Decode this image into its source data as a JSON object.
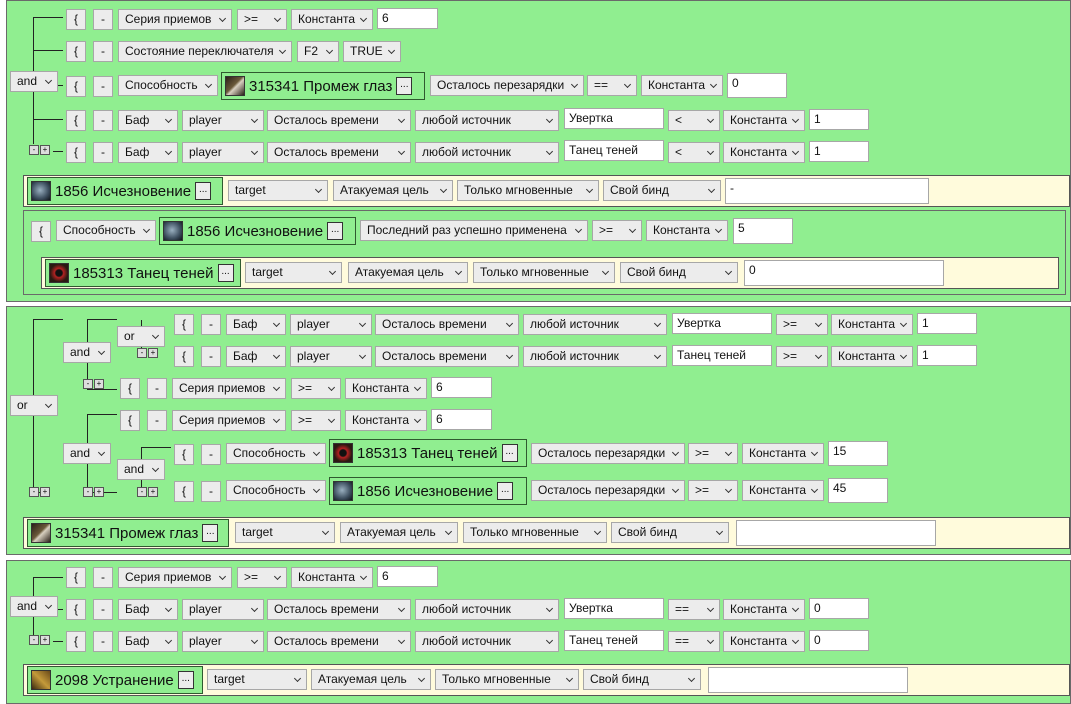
{
  "common": {
    "brace": "{",
    "dash": "-",
    "more": "...",
    "and": "and",
    "or": "or",
    "combo_series": "Серия приемов",
    "switch_state": "Состояние переключателя",
    "ability": "Способность",
    "buff": "Баф",
    "player": "player",
    "time_left": "Осталось времени",
    "any_source": "любой источник",
    "const": "Константа",
    "cd_left": "Осталось перезарядки",
    "last_success": "Последний раз успешно применена",
    "target": "target",
    "attacked": "Атакуемая цель",
    "instant": "Только мгновенные",
    "own_bind": "Свой бинд",
    "op_ge": ">=",
    "op_eq": "==",
    "op_lt": "<",
    "f2": "F2",
    "true_val": "TRUE",
    "evasion": "Увертка",
    "shadow_dance": "Танец теней"
  },
  "icons": [
    "blade-icon",
    "vanish-icon",
    "shadow-dance-icon",
    "eliminate-icon"
  ],
  "spells": {
    "s315341": "315341 Промеж глаз",
    "s1856": "1856 Исчезновение",
    "s185313": "185313 Танец теней",
    "s2098": "2098 Устранение"
  },
  "values": {
    "b1_r1": "6",
    "b1_r3": "0",
    "b1_r4": "1",
    "b1_r5": "1",
    "b1_act": "-",
    "b1_sub": "5",
    "b1_sub_act": "0",
    "b2_r1": "1",
    "b2_r2": "1",
    "b2_r3": "6",
    "b2_r4": "6",
    "b2_r5": "15",
    "b2_r6": "45",
    "b3_r1": "6",
    "b3_r2": "0",
    "b3_r3": "0"
  }
}
